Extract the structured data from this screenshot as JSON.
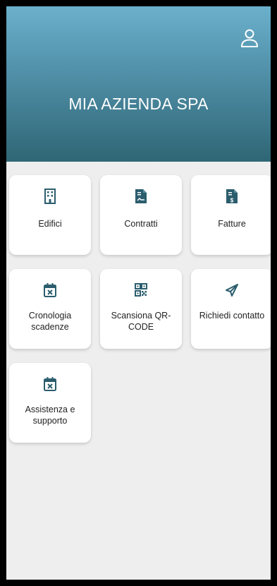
{
  "header": {
    "title": "MIA AZIENDA SPA",
    "profile_icon": "user-profile-icon"
  },
  "colors": {
    "header_top": "#6bb0cc",
    "header_bottom": "#2f6675",
    "icon_color": "#2b5d6d",
    "background": "#eeeeee"
  },
  "tiles": [
    {
      "label": "Edifici",
      "icon": "building-icon"
    },
    {
      "label": "Contratti",
      "icon": "contract-document-icon"
    },
    {
      "label": "Fatture",
      "icon": "invoice-document-icon"
    },
    {
      "label": "Cronologia scadenze",
      "icon": "calendar-cross-icon"
    },
    {
      "label": "Scansiona QR-CODE",
      "icon": "qr-code-icon"
    },
    {
      "label": "Richiedi contatto",
      "icon": "send-icon"
    },
    {
      "label": "Assistenza e supporto",
      "icon": "calendar-cross-icon"
    }
  ]
}
